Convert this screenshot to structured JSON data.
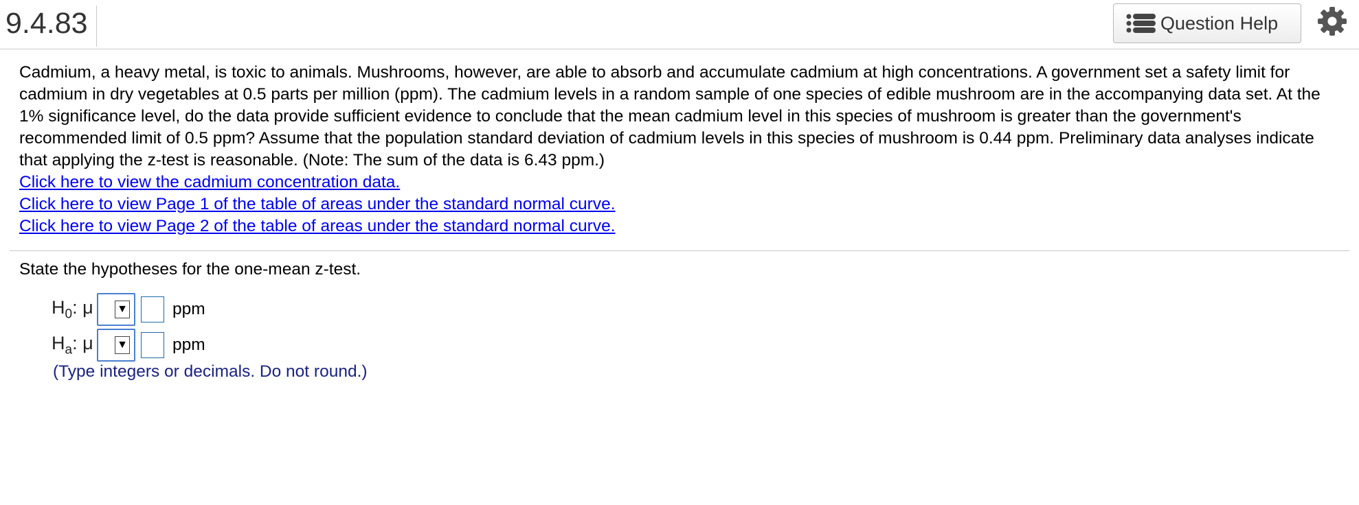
{
  "header": {
    "question_number": "9.4.83",
    "help_button_label": "Question Help",
    "help_icon": "list-icon",
    "settings_icon": "gear-icon"
  },
  "problem": {
    "text": "Cadmium, a heavy metal, is toxic to animals. Mushrooms, however, are able to absorb and accumulate cadmium at high concentrations. A government set a safety limit for cadmium in dry vegetables at 0.5 parts per million (ppm). The cadmium levels in a random sample of one species of edible mushroom are in the accompanying data set. At the 1% significance level, do the data provide sufficient evidence to conclude that the mean cadmium level in this species of mushroom is greater than the government's recommended limit of 0.5 ppm? Assume that the population standard deviation of cadmium levels in this species of mushroom is 0.44 ppm. Preliminary data analyses indicate that applying the z-test is reasonable. (Note: The sum of the data is 6.43 ppm.)",
    "links": [
      "Click here to view the cadmium concentration data.",
      "Click here to view Page 1 of the table of areas under the standard normal curve.",
      "Click here to view Page 2 of the table of areas under the standard normal curve."
    ]
  },
  "question": {
    "prompt": "State the hypotheses for the one-mean z-test.",
    "null": {
      "letter": "H",
      "sub": "0",
      "param": ": μ",
      "relation_value": "",
      "number_value": "",
      "unit": "ppm"
    },
    "alt": {
      "letter": "H",
      "sub": "a",
      "param": ": μ",
      "relation_value": "",
      "number_value": "",
      "unit": "ppm"
    },
    "dropdown_arrow": "▼",
    "note": "(Type integers or decimals. Do not round.)"
  },
  "colors": {
    "link": "#0000ee",
    "note": "#1a237e",
    "dropdown_border": "#4a7fd0",
    "input_border": "#1d6aa8"
  }
}
